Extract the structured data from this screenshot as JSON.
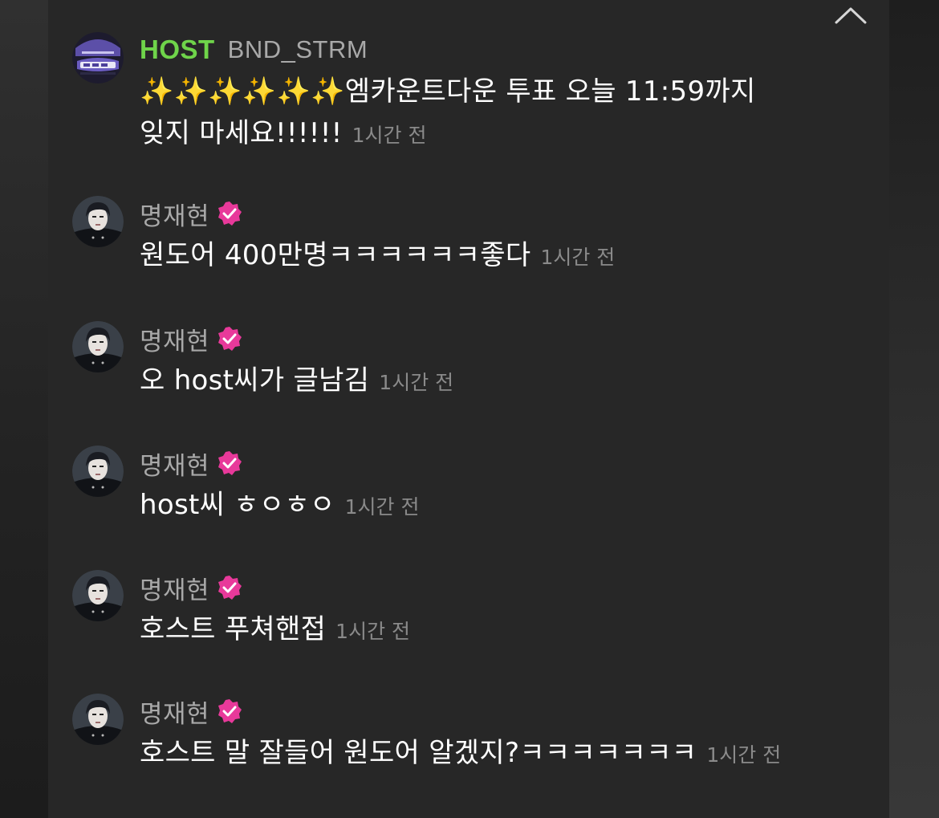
{
  "chat": {
    "host_badge": "HOST",
    "messages": [
      {
        "author": "BND_STRM",
        "is_host": true,
        "text": "✨✨✨✨✨✨엠카운트다운 투표 오늘 11:59까지 잊지 마세요!!!!!!",
        "time": "1시간 전"
      },
      {
        "author": "명재현",
        "verified": true,
        "text": "원도어 400만명ㅋㅋㅋㅋㅋㅋ좋다",
        "time": "1시간 전"
      },
      {
        "author": "명재현",
        "verified": true,
        "text": "오 host씨가 글남김",
        "time": "1시간 전"
      },
      {
        "author": "명재현",
        "verified": true,
        "text": "host씨 ㅎㅇㅎㅇ",
        "time": "1시간 전"
      },
      {
        "author": "명재현",
        "verified": true,
        "text": "호스트 푸쳐핸접",
        "time": "1시간 전"
      },
      {
        "author": "명재현",
        "verified": true,
        "text": "호스트 말 잘들어 원도어 알겠지?ㅋㅋㅋㅋㅋㅋㅋ",
        "time": "1시간 전"
      }
    ]
  },
  "colors": {
    "host_badge": "#6fd44a",
    "author": "#a9a9a9",
    "message_text": "#ffffff",
    "timestamp": "#8a8a8a",
    "verified_badge": "#e8399a",
    "panel_background": "#272727"
  },
  "icons": {
    "collapse": "chevron-up-icon",
    "verified": "verified-badge-icon"
  }
}
